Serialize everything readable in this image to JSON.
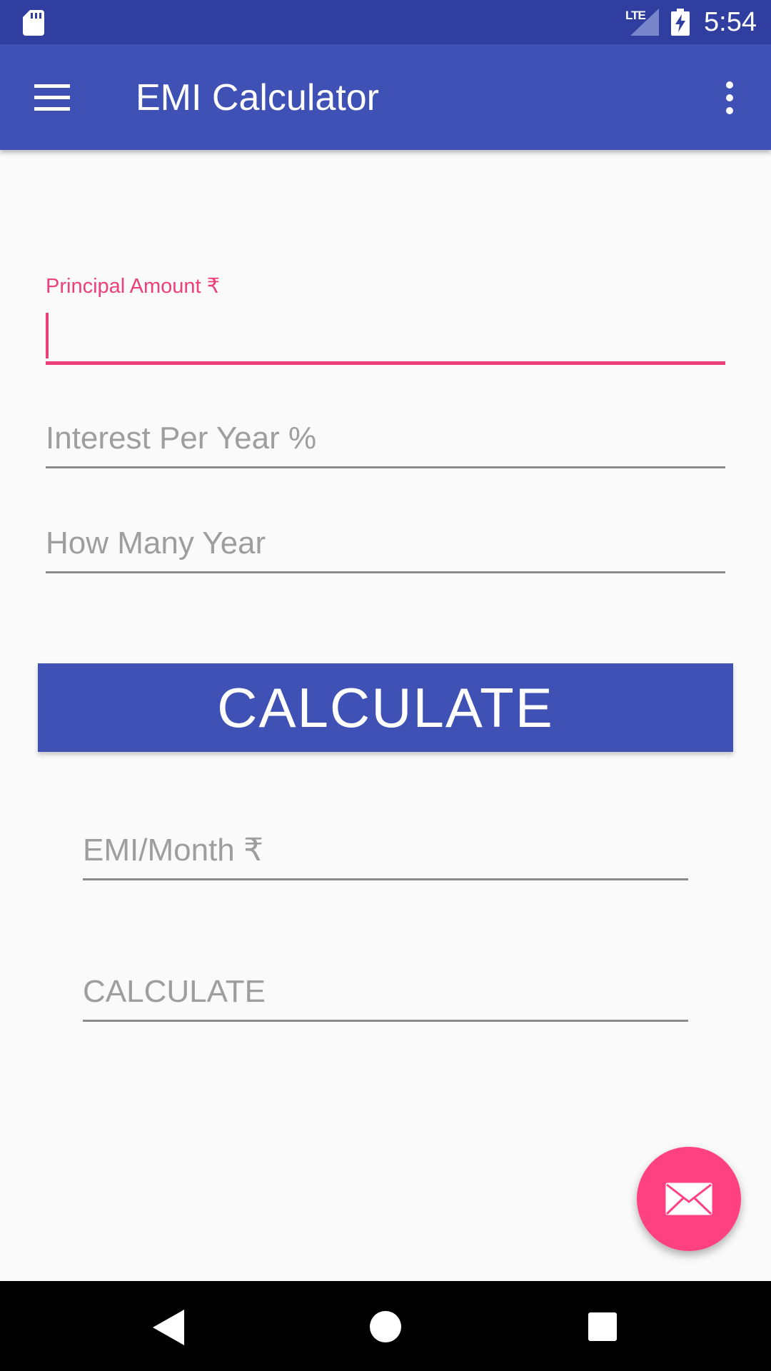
{
  "status_bar": {
    "time": "5:54",
    "network": "LTE"
  },
  "app_bar": {
    "title": "EMI Calculator"
  },
  "form": {
    "principal": {
      "label": "Principal Amount ₹",
      "value": ""
    },
    "interest": {
      "placeholder": "Interest Per Year %"
    },
    "years": {
      "placeholder": "How Many Year"
    },
    "calculate_label": "CALCULATE"
  },
  "results": {
    "emi": {
      "placeholder": "EMI/Month ₹"
    },
    "total": {
      "placeholder": "CALCULATE"
    }
  },
  "colors": {
    "primary": "#3F51B5",
    "primary_dark": "#303F9F",
    "accent": "#FF4081",
    "field_active": "#EC407A",
    "hint": "#9E9E9E"
  },
  "icons": {
    "status": [
      "sd-card-icon",
      "signal-icon",
      "battery-charging-icon"
    ],
    "app_bar": [
      "menu-icon",
      "more-vert-icon"
    ],
    "fab": "mail-icon",
    "nav": [
      "back-icon",
      "home-icon",
      "recents-icon"
    ]
  }
}
